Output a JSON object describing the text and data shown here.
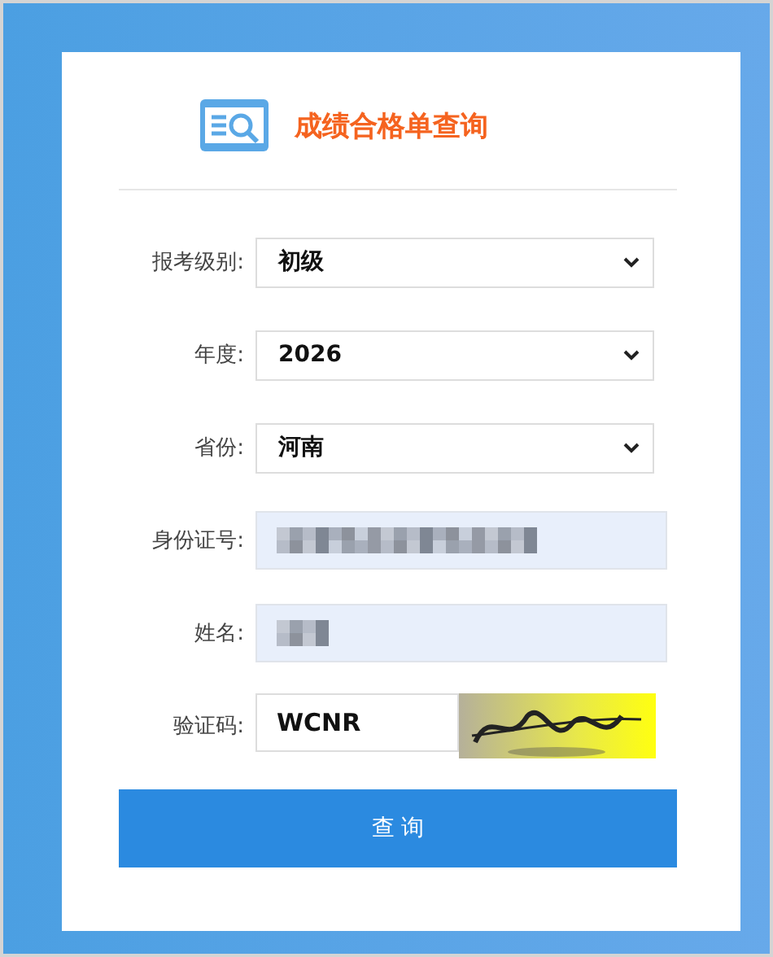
{
  "title": "成绩合格单查询",
  "fields": [
    {
      "kind": "select",
      "label": "报考级别:",
      "value": "初级"
    },
    {
      "kind": "select",
      "label": "年度:",
      "value": "2026"
    },
    {
      "kind": "select",
      "label": "省份:",
      "value": "河南"
    },
    {
      "kind": "redacted",
      "label": "身份证号:"
    },
    {
      "kind": "redacted",
      "label": "姓名:"
    },
    {
      "kind": "captcha",
      "label": "验证码:",
      "value": "WCNR"
    }
  ],
  "submit": "查 询"
}
